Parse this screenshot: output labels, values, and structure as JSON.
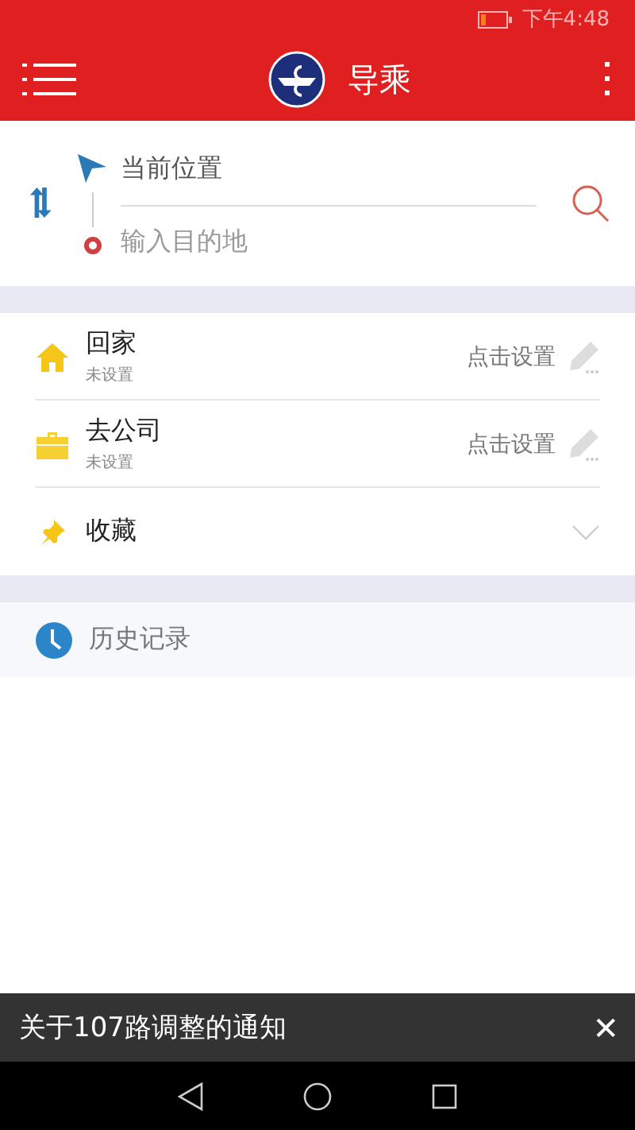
{
  "status_bar": {
    "time": "下午4:48"
  },
  "header": {
    "title": "导乘"
  },
  "route": {
    "origin": "当前位置",
    "destination_placeholder": "输入目的地"
  },
  "places": [
    {
      "kind": "home",
      "title": "回家",
      "subtitle": "未设置",
      "action": "点击设置"
    },
    {
      "kind": "work",
      "title": "去公司",
      "subtitle": "未设置",
      "action": "点击设置"
    },
    {
      "kind": "favorites",
      "title": "收藏",
      "expanded": false
    }
  ],
  "history": {
    "label": "历史记录"
  },
  "notice": {
    "text": "关于107路调整的通知",
    "close": "✕"
  }
}
